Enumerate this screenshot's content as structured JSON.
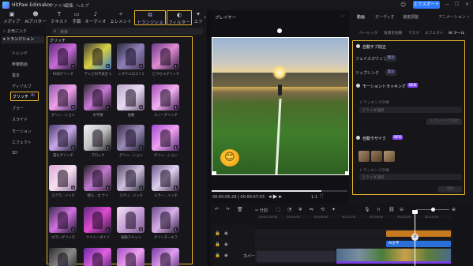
{
  "app": {
    "title": "HitPaw Edimakor",
    "menus": [
      "ファイル",
      "編集",
      "ヘルプ"
    ],
    "export_label": "エクスポート"
  },
  "tooltabs": [
    {
      "label": "メディア",
      "icon": "media-icon"
    },
    {
      "label": "AIアバター",
      "icon": "ai-avatar-icon"
    },
    {
      "label": "テキスト",
      "icon": "text-icon"
    },
    {
      "label": "字幕",
      "icon": "subtitle-icon"
    },
    {
      "label": "オーディオ",
      "icon": "audio-icon"
    },
    {
      "label": "エレメント",
      "icon": "element-icon"
    },
    {
      "label": "トランジション",
      "icon": "transition-icon",
      "active": true
    },
    {
      "label": "フィルター",
      "icon": "filter-icon"
    },
    {
      "label": "エフ",
      "icon": "effect-icon"
    }
  ],
  "sidebar": {
    "items": [
      {
        "label": "お気に入り"
      },
      {
        "label": "トランジション"
      },
      {
        "label": "トレンド"
      },
      {
        "label": "幹審動画"
      },
      {
        "label": "基本"
      },
      {
        "label": "ディゾルブ"
      },
      {
        "label": "グリッチ",
        "active": true
      },
      {
        "label": "ブラー"
      },
      {
        "label": "スライド"
      },
      {
        "label": "モーション"
      },
      {
        "label": "エフェクト"
      },
      {
        "label": "3D"
      }
    ]
  },
  "library": {
    "search_placeholder": "検索",
    "category_title": "グリッチ",
    "items": [
      {
        "label": "RGBグリッチ"
      },
      {
        "label": "テレビの不具合 1"
      },
      {
        "label": "シグナルロスト1"
      },
      {
        "label": "ピクセルグリッチ"
      },
      {
        "label": "グリッ...ション"
      },
      {
        "label": "水平線"
      },
      {
        "label": "振動"
      },
      {
        "label": "スノーグリッチ"
      },
      {
        "label": "霞むグリッチ"
      },
      {
        "label": "ブロック"
      },
      {
        "label": "グリッ...ション"
      },
      {
        "label": "グリッ...ション"
      },
      {
        "label": "スクラ...リッチ"
      },
      {
        "label": "揺る...カ ナイ"
      },
      {
        "label": "スクリ...リッチ"
      },
      {
        "label": "ミラー...リッチ"
      },
      {
        "label": "エラーグリッチ"
      },
      {
        "label": "ナイトーボイド"
      },
      {
        "label": "振動スキャン"
      },
      {
        "label": "グリッチ一エフ"
      },
      {
        "label": ""
      },
      {
        "label": ""
      },
      {
        "label": ""
      },
      {
        "label": ""
      }
    ]
  },
  "player": {
    "title": "プレイヤー",
    "time_current": "00:00:05:29",
    "time_total": "00:00:07:03",
    "zoom": "1:1",
    "progress": 0.81
  },
  "right_panel": {
    "tabs": [
      "動画",
      "オーディオ",
      "速度調整",
      "アニメーション"
    ],
    "subtabs": [
      "ベーシック",
      "背景を削除",
      "マスク",
      "エフェクト",
      "AI ツール"
    ],
    "sections": {
      "auto_cut": {
        "title": "自動チブ削正",
        "label1": "フェイススワップ",
        "btn1": "無効",
        "label2": "リップシンク",
        "btn2": "無効"
      },
      "motion_tracking": {
        "title": "モーショントラッキング",
        "new": "NEW",
        "field_label": "トラッキング対象",
        "placeholder": "スライダ選択",
        "start_btn": "トラッキング開始"
      },
      "auto_mosaic": {
        "title": "自動モザイク",
        "new": "NEW",
        "field_label": "トラッキング対象",
        "placeholder": "スライダ選択",
        "start_btn": "開始"
      }
    }
  },
  "timeline": {
    "split_label": "分割",
    "track_label": "カバー",
    "clip_label": "AI文字",
    "ruler_marks": [
      "00:01:00:00",
      "00:04:00",
      "00:08:00",
      "00:12:00",
      "00:16:00",
      "00:20:00",
      "00:24:00"
    ]
  }
}
